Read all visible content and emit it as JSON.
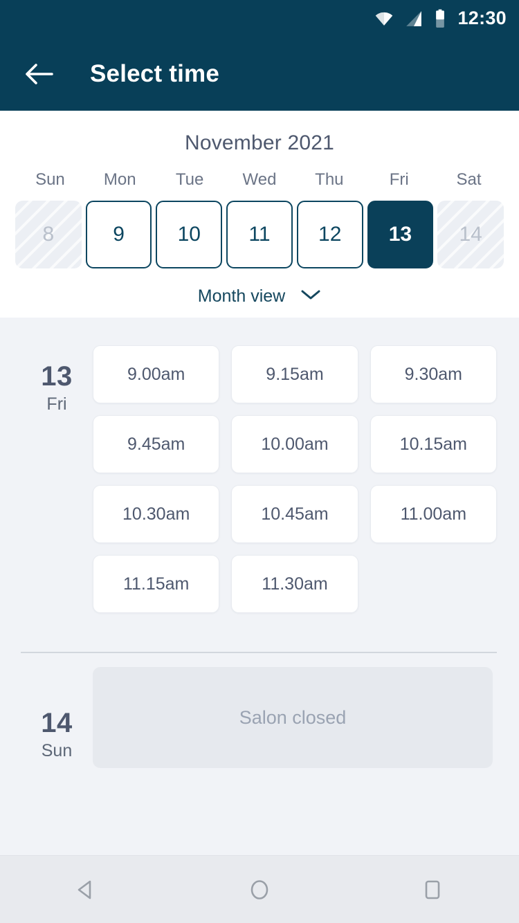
{
  "status_bar": {
    "time": "12:30",
    "icons": [
      "wifi-icon",
      "cellular-signal-icon",
      "battery-icon"
    ]
  },
  "app_bar": {
    "back_icon": "back-arrow-icon",
    "title": "Select time"
  },
  "calendar": {
    "month_title": "November 2021",
    "weekdays": [
      "Sun",
      "Mon",
      "Tue",
      "Wed",
      "Thu",
      "Fri",
      "Sat"
    ],
    "days": [
      {
        "number": "8",
        "state": "disabled"
      },
      {
        "number": "9",
        "state": "available"
      },
      {
        "number": "10",
        "state": "available"
      },
      {
        "number": "11",
        "state": "available"
      },
      {
        "number": "12",
        "state": "available"
      },
      {
        "number": "13",
        "state": "selected"
      },
      {
        "number": "14",
        "state": "disabled"
      }
    ],
    "month_view_label": "Month view",
    "month_view_icon": "chevron-down-icon"
  },
  "schedule": {
    "groups": [
      {
        "day_number": "13",
        "day_name": "Fri",
        "slots": [
          "9.00am",
          "9.15am",
          "9.30am",
          "9.45am",
          "10.00am",
          "10.15am",
          "10.30am",
          "10.45am",
          "11.00am",
          "11.15am",
          "11.30am"
        ]
      },
      {
        "day_number": "14",
        "day_name": "Sun",
        "closed_message": "Salon closed"
      }
    ]
  },
  "nav_bar": {
    "back_label": "back-triangle-icon",
    "home_label": "home-circle-icon",
    "recents_label": "recents-square-icon"
  },
  "colors": {
    "brand_dark": "#083f58",
    "selected_day": "#0a4059",
    "panel_bg": "#f1f3f7",
    "slot_text": "#4e586e",
    "closed_box": "#e6e9ee"
  }
}
